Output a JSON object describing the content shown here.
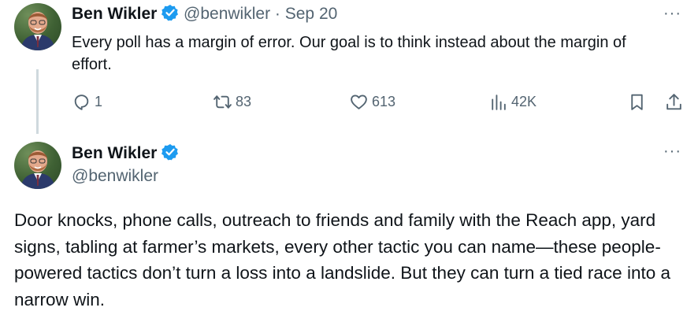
{
  "tweet1": {
    "author_name": "Ben Wikler",
    "handle": "@benwikler",
    "separator": "·",
    "date": "Sep 20",
    "text": "Every poll has a margin of error. Our goal is to think instead about the margin of effort.",
    "more_label": "···",
    "actions": {
      "replies": "1",
      "reposts": "83",
      "likes": "613",
      "views": "42K"
    },
    "icons": {
      "verified": "verified-badge-icon",
      "reply": "reply-icon",
      "repost": "repost-icon",
      "like": "heart-icon",
      "views": "views-icon",
      "bookmark": "bookmark-icon",
      "share": "share-icon"
    }
  },
  "tweet2": {
    "author_name": "Ben Wikler",
    "handle": "@benwikler",
    "more_label": "···",
    "text": "Door knocks, phone calls, outreach to friends and family with the Reach app, yard signs, tabling at farmer’s markets, every other tactic you can name—these people-powered tactics don’t turn a loss into a landslide. But they can turn a tied race into a narrow win."
  },
  "colors": {
    "text": "#0f1419",
    "muted": "#536471",
    "verified": "#1d9bf0",
    "thread_line": "#cfd9de"
  }
}
